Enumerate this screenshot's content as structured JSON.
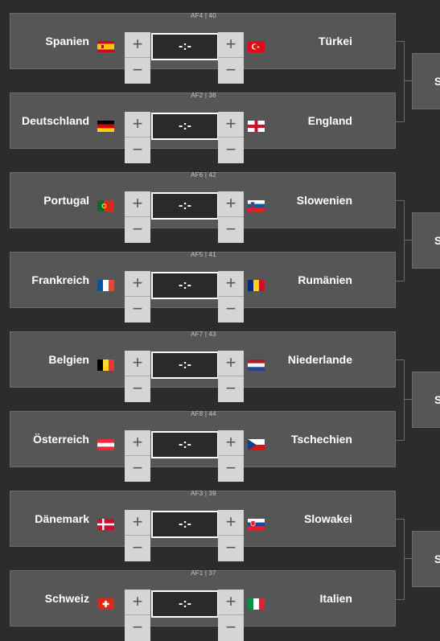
{
  "matches": [
    {
      "code": "AF4 | 40",
      "home": "Spanien",
      "away": "Türkei",
      "home_flag": "spain-flag-icon",
      "away_flag": "turkey-flag-icon",
      "score": "-:-"
    },
    {
      "code": "AF2 | 38",
      "home": "Deutschland",
      "away": "England",
      "home_flag": "germany-flag-icon",
      "away_flag": "england-flag-icon",
      "score": "-:-"
    },
    {
      "code": "AF6 | 42",
      "home": "Portugal",
      "away": "Slowenien",
      "home_flag": "portugal-flag-icon",
      "away_flag": "slovenia-flag-icon",
      "score": "-:-"
    },
    {
      "code": "AF5 | 41",
      "home": "Frankreich",
      "away": "Rumänien",
      "home_flag": "france-flag-icon",
      "away_flag": "romania-flag-icon",
      "score": "-:-"
    },
    {
      "code": "AF7 | 43",
      "home": "Belgien",
      "away": "Niederlande",
      "home_flag": "belgium-flag-icon",
      "away_flag": "netherlands-flag-icon",
      "score": "-:-"
    },
    {
      "code": "AF8 | 44",
      "home": "Österreich",
      "away": "Tschechien",
      "home_flag": "austria-flag-icon",
      "away_flag": "czechia-flag-icon",
      "score": "-:-"
    },
    {
      "code": "AF3 | 39",
      "home": "Dänemark",
      "away": "Slowakei",
      "home_flag": "denmark-flag-icon",
      "away_flag": "slovakia-flag-icon",
      "score": "-:-"
    },
    {
      "code": "AF1 | 37",
      "home": "Schweiz",
      "away": "Italien",
      "home_flag": "switzerland-flag-icon",
      "away_flag": "italy-flag-icon",
      "score": "-:-"
    }
  ],
  "stepper": {
    "plus": "+",
    "minus": "−"
  },
  "next_round": [
    {
      "label": "S"
    },
    {
      "label": "S"
    },
    {
      "label": "S"
    },
    {
      "label": "S"
    }
  ],
  "colors": {
    "card": "#565656",
    "background": "#2c2c2c",
    "score_bg": "#2a2a2a",
    "stepper_bg": "#d5d5d5"
  }
}
